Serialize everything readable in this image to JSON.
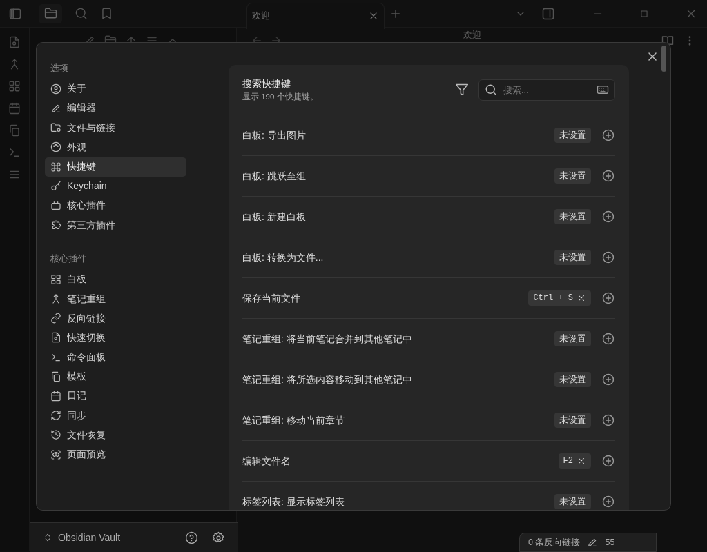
{
  "app": {
    "tab": {
      "title": "欢迎",
      "selected": true
    },
    "note_title": "欢迎",
    "vault": "Obsidian Vault",
    "status_bar": [
      "0 条反向链接",
      "55"
    ]
  },
  "settings": {
    "groups": [
      {
        "heading": "选项",
        "items": [
          {
            "label": "关于",
            "selected": false
          },
          {
            "label": "编辑器",
            "selected": false
          },
          {
            "label": "文件与链接",
            "selected": false
          },
          {
            "label": "外观",
            "selected": false
          },
          {
            "label": "快捷键",
            "selected": true
          },
          {
            "label": "Keychain",
            "selected": false
          },
          {
            "label": "核心插件",
            "selected": false
          },
          {
            "label": "第三方插件",
            "selected": false
          }
        ]
      },
      {
        "heading": "核心插件",
        "items": [
          {
            "label": "白板",
            "selected": false
          },
          {
            "label": "笔记重组",
            "selected": false
          },
          {
            "label": "反向链接",
            "selected": false
          },
          {
            "label": "快速切换",
            "selected": false
          },
          {
            "label": "命令面板",
            "selected": false
          },
          {
            "label": "模板",
            "selected": false
          },
          {
            "label": "日记",
            "selected": false
          },
          {
            "label": "同步",
            "selected": false
          },
          {
            "label": "文件恢复",
            "selected": false
          },
          {
            "label": "页面预览",
            "selected": false
          }
        ]
      }
    ]
  },
  "hotkeys": {
    "title": "搜索快捷键",
    "subtitle": "显示 190 个快捷键。",
    "search": {
      "placeholder": "搜索..."
    },
    "rows": [
      {
        "command": "白板: 导出图片",
        "keys": [
          {
            "kind": "unset",
            "text": "未设置"
          }
        ]
      },
      {
        "command": "白板: 跳跃至组",
        "keys": [
          {
            "kind": "unset",
            "text": "未设置"
          }
        ]
      },
      {
        "command": "白板: 新建白板",
        "keys": [
          {
            "kind": "unset",
            "text": "未设置"
          }
        ]
      },
      {
        "command": "白板: 转换为文件...",
        "keys": [
          {
            "kind": "unset",
            "text": "未设置"
          }
        ]
      },
      {
        "command": "保存当前文件",
        "keys": [
          {
            "kind": "set",
            "text": "Ctrl + S"
          }
        ]
      },
      {
        "command": "笔记重组: 将当前笔记合并到其他笔记中",
        "keys": [
          {
            "kind": "unset",
            "text": "未设置"
          }
        ]
      },
      {
        "command": "笔记重组: 将所选内容移动到其他笔记中",
        "keys": [
          {
            "kind": "unset",
            "text": "未设置"
          }
        ]
      },
      {
        "command": "笔记重组: 移动当前章节",
        "keys": [
          {
            "kind": "unset",
            "text": "未设置"
          }
        ]
      },
      {
        "command": "编辑文件名",
        "keys": [
          {
            "kind": "set",
            "text": "F2"
          }
        ]
      },
      {
        "command": "标签列表: 显示标签列表",
        "keys": [
          {
            "kind": "unset",
            "text": "未设置"
          }
        ]
      }
    ]
  }
}
